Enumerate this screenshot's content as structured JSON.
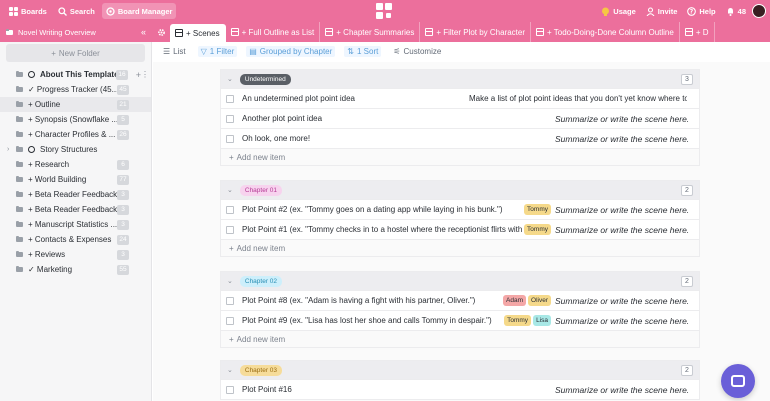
{
  "topbar": {
    "boards": "Boards",
    "search": "Search",
    "board_manager": "Board Manager",
    "usage": "Usage",
    "invite": "Invite",
    "help": "Help",
    "notifications": "48"
  },
  "sidebar": {
    "title": "Novel Writing Overview",
    "new_folder": "New Folder",
    "items": [
      {
        "label": "About This Template",
        "count": "16"
      },
      {
        "label": "✓ Progress Tracker (45...",
        "count": "45"
      },
      {
        "label": "+ Outline",
        "count": "21"
      },
      {
        "label": "+ Synopsis (Snowflake ...",
        "count": "5"
      },
      {
        "label": "+ Character Profiles & ...",
        "count": "26"
      },
      {
        "label": "Story Structures",
        "count": ""
      },
      {
        "label": "+ Research",
        "count": "6"
      },
      {
        "label": "+ World Building",
        "count": "77"
      },
      {
        "label": "+ Beta Reader Feedback...",
        "count": "3"
      },
      {
        "label": "+ Beta Reader Feedback...",
        "count": "3"
      },
      {
        "label": "+ Manuscript Statistics ...",
        "count": "3"
      },
      {
        "label": "+ Contacts & Expenses",
        "count": "24"
      },
      {
        "label": "+ Reviews",
        "count": "3"
      },
      {
        "label": "✓ Marketing",
        "count": "55"
      }
    ]
  },
  "tabs": [
    {
      "label": "+ Scenes"
    },
    {
      "label": "+ Full Outline as List"
    },
    {
      "label": "+ Chapter Summaries"
    },
    {
      "label": "+ Filter Plot by Character"
    },
    {
      "label": "+ Todo-Doing-Done Column Outline"
    },
    {
      "label": "+ D"
    }
  ],
  "toolbar": {
    "list": "List",
    "filter": "1 Filter",
    "grouped": "Grouped by Chapter",
    "sort": "1 Sort",
    "customize": "Customize"
  },
  "add_new": "Add new item",
  "groups": [
    {
      "name": "Undetermined",
      "count": "3",
      "badge_bg": "#5a5f66",
      "badge_fg": "#ffffff",
      "rows": [
        {
          "name": "An undetermined plot point idea",
          "desc": "Make a list of plot point ideas that you don't yet know where to",
          "plain": true,
          "tags": []
        },
        {
          "name": "Another plot point idea",
          "desc": "Summarize or write the scene here.",
          "plain": false,
          "tags": []
        },
        {
          "name": "Oh look, one more!",
          "desc": "Summarize or write the scene here.",
          "plain": false,
          "tags": []
        }
      ]
    },
    {
      "name": "Chapter 01",
      "count": "2",
      "badge_bg": "#f7d3ee",
      "badge_fg": "#b63a95",
      "rows": [
        {
          "name": "Plot Point #2 (ex. \"Tommy goes on a dating app while laying in his bunk.\")",
          "desc": "Summarize or write the scene here.",
          "plain": false,
          "tags": [
            {
              "label": "Tommy",
              "color": "#f5d98a"
            }
          ]
        },
        {
          "name": "Plot Point #1 (ex. \"Tommy checks in to a hostel where the receptionist flirts with him.\")",
          "desc": "Summarize or write the scene here.",
          "plain": false,
          "tags": [
            {
              "label": "Tommy",
              "color": "#f5d98a"
            }
          ]
        }
      ]
    },
    {
      "name": "Chapter 02",
      "count": "2",
      "badge_bg": "#cdeffb",
      "badge_fg": "#2a8fb4",
      "rows": [
        {
          "name": "Plot Point #8 (ex. \"Adam is having a fight with his partner, Oliver.\")",
          "desc": "Summarize or write the scene here.",
          "plain": false,
          "tags": [
            {
              "label": "Adam",
              "color": "#f4a7a7"
            },
            {
              "label": "Oliver",
              "color": "#f5d98a"
            }
          ]
        },
        {
          "name": "Plot Point #9 (ex. \"Lisa has lost her shoe and calls Tommy in despair.\")",
          "desc": "Summarize or write the scene here.",
          "plain": false,
          "tags": [
            {
              "label": "Tommy",
              "color": "#f5d98a"
            },
            {
              "label": "Lisa",
              "color": "#a8e8e6"
            }
          ]
        }
      ]
    },
    {
      "name": "Chapter 03",
      "count": "2",
      "badge_bg": "#f6dc9a",
      "badge_fg": "#9a6d12",
      "rows": [
        {
          "name": "Plot Point #16",
          "desc": "Summarize or write the scene here.",
          "plain": false,
          "tags": []
        }
      ]
    }
  ]
}
